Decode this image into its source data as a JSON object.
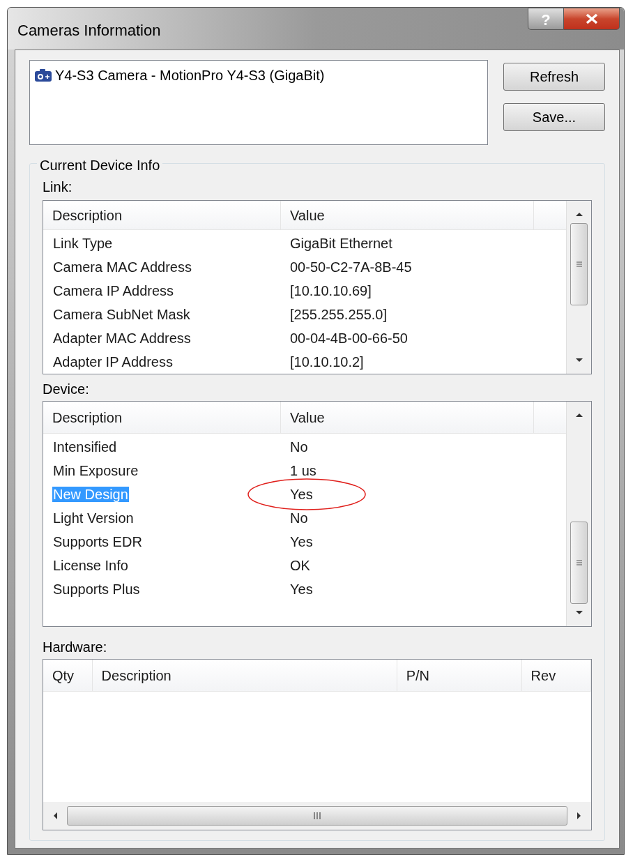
{
  "window": {
    "title": "Cameras Information",
    "help": "?"
  },
  "cameras": [
    {
      "label": "Y4-S3 Camera - MotionPro Y4-S3 (GigaBit)",
      "selected": false
    }
  ],
  "buttons": [
    "Refresh",
    "Save..."
  ],
  "group": {
    "title": "Current Device Info"
  },
  "link": {
    "label": "Link:",
    "columns": [
      "Description",
      "Value"
    ],
    "rows": [
      {
        "description": "Link Type",
        "value": "GigaBit Ethernet"
      },
      {
        "description": "Camera MAC Address",
        "value": "00-50-C2-7A-8B-45"
      },
      {
        "description": "Camera IP Address",
        "value": "[10.10.10.69]"
      },
      {
        "description": "Camera SubNet Mask",
        "value": "[255.255.255.0]"
      },
      {
        "description": "Adapter MAC Address",
        "value": "00-04-4B-00-66-50"
      },
      {
        "description": "Adapter IP Address",
        "value": "[10.10.10.2]"
      }
    ]
  },
  "device": {
    "label": "Device:",
    "columns": [
      "Description",
      "Value"
    ],
    "rows": [
      {
        "description": "Intensified",
        "value": "No",
        "selected": false,
        "circled": false
      },
      {
        "description": "Min Exposure",
        "value": "1 us",
        "selected": false,
        "circled": false
      },
      {
        "description": "New Design",
        "value": "Yes",
        "selected": true,
        "circled": true
      },
      {
        "description": "Light Version",
        "value": "No",
        "selected": false,
        "circled": false
      },
      {
        "description": "Supports EDR",
        "value": "Yes",
        "selected": false,
        "circled": false
      },
      {
        "description": "License Info",
        "value": "OK",
        "selected": false,
        "circled": false
      },
      {
        "description": "Supports Plus",
        "value": "Yes",
        "selected": false,
        "circled": false
      }
    ]
  },
  "hardware": {
    "label": "Hardware:",
    "columns": [
      "Qty",
      "Description",
      "P/N",
      "Rev"
    ]
  }
}
